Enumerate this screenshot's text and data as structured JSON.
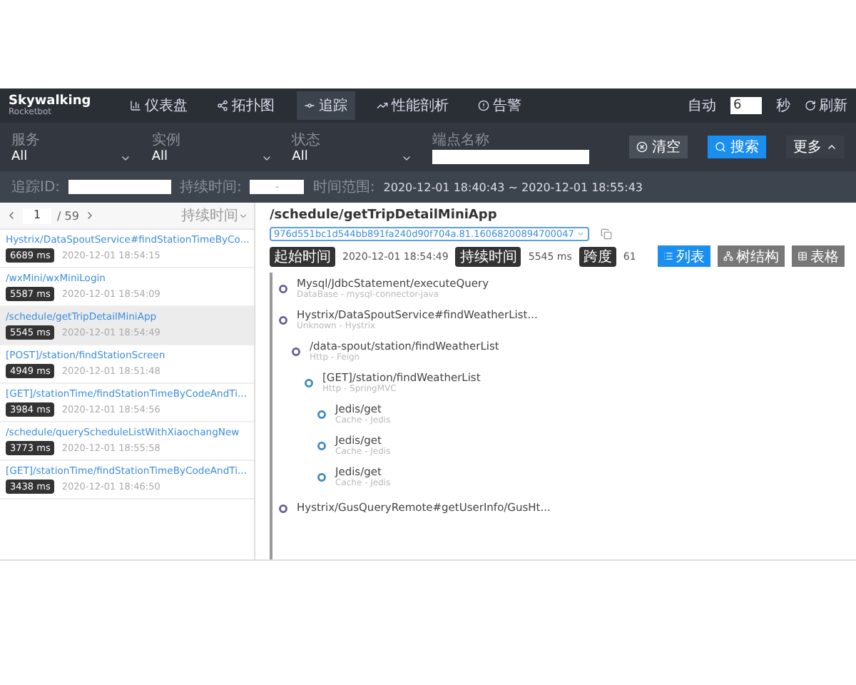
{
  "brand": {
    "name": "Skywalking",
    "sub": "Rocketbot"
  },
  "nav": [
    {
      "label": "仪表盘",
      "selected": false
    },
    {
      "label": "拓扑图",
      "selected": false
    },
    {
      "label": "追踪",
      "selected": true
    },
    {
      "label": "性能剖析",
      "selected": false
    },
    {
      "label": "告警",
      "selected": false
    }
  ],
  "auto_refresh": {
    "label": "自动",
    "value": "6",
    "unit": "秒",
    "refresh": "刷新"
  },
  "filters": [
    {
      "label": "服务",
      "value": "All",
      "kind": "select"
    },
    {
      "label": "实例",
      "value": "All",
      "kind": "select"
    },
    {
      "label": "状态",
      "value": "All",
      "kind": "select"
    },
    {
      "label": "端点名称",
      "kind": "input"
    }
  ],
  "actions": [
    {
      "label": "清空",
      "kind": "clear"
    },
    {
      "label": "搜索",
      "kind": "search"
    },
    {
      "label": "更多",
      "kind": "more"
    }
  ],
  "search_row": {
    "trace_id_label": "追踪ID:",
    "duration_label": "持续时间:",
    "duration_sep": "-",
    "range_label": "时间范围:",
    "range": "2020-12-01 18:40:43 ~ 2020-12-01 18:55:43"
  },
  "pager": {
    "page": "1",
    "total": "/ 59",
    "sort": "持续时间"
  },
  "traces": [
    {
      "name": "Hystrix/DataSpoutService#findStationTimeByCo...",
      "duration": "6689 ms",
      "time": "2020-12-01 18:54:15",
      "selected": false
    },
    {
      "name": "/wxMini/wxMiniLogin",
      "duration": "5587 ms",
      "time": "2020-12-01 18:54:09",
      "selected": false
    },
    {
      "name": "/schedule/getTripDetailMiniApp",
      "duration": "5545 ms",
      "time": "2020-12-01 18:54:49",
      "selected": true
    },
    {
      "name": "[POST]/station/findStationScreen",
      "duration": "4949 ms",
      "time": "2020-12-01 18:51:48",
      "selected": false
    },
    {
      "name": "[GET]/stationTime/findStationTimeByCodeAndTi...",
      "duration": "3984 ms",
      "time": "2020-12-01 18:54:56",
      "selected": false
    },
    {
      "name": "/schedule/queryScheduleListWithXiaochangNew",
      "duration": "3773 ms",
      "time": "2020-12-01 18:55:58",
      "selected": false
    },
    {
      "name": "[GET]/stationTime/findStationTimeByCodeAndTi...",
      "duration": "3438 ms",
      "time": "2020-12-01 18:46:50",
      "selected": false
    }
  ],
  "detail": {
    "title": "/schedule/getTripDetailMiniApp",
    "trace_id": "976d551bc1d544bb891fa240d90f704a.81.16068200894700047",
    "tags": [
      {
        "label": "起始时间",
        "value": "2020-12-01 18:54:49"
      },
      {
        "label": "持续时间",
        "value": "5545 ms"
      },
      {
        "label": "跨度",
        "value": "61"
      }
    ],
    "views": [
      {
        "label": "列表",
        "selected": true
      },
      {
        "label": "树结构",
        "selected": false
      },
      {
        "label": "表格",
        "selected": false
      }
    ],
    "spans": [
      {
        "name": "Mysql/JdbcStatement/executeQuery",
        "sub": "DataBase - mysql-connector-java"
      },
      {
        "name": "Hystrix/DataSpoutService#findWeatherList...",
        "sub": "Unknown - Hystrix",
        "children": [
          {
            "name": "/data-spout/station/findWeatherList",
            "sub": "Http - Feign",
            "children": [
              {
                "name": "[GET]/station/findWeatherList",
                "sub": "Http - SpringMVC",
                "children": [
                  {
                    "name": "Jedis/get",
                    "sub": "Cache - Jedis"
                  },
                  {
                    "name": "Jedis/get",
                    "sub": "Cache - Jedis"
                  },
                  {
                    "name": "Jedis/get",
                    "sub": "Cache - Jedis"
                  }
                ]
              }
            ]
          }
        ]
      },
      {
        "name": "Hystrix/GusQueryRemote#getUserInfo/GusHt..."
      }
    ]
  }
}
